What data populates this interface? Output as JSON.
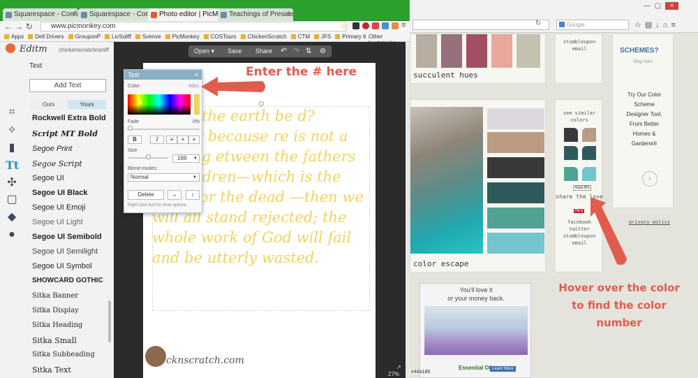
{
  "browser": {
    "tabs": [
      {
        "label": "Squarespace - Configurati",
        "active": false
      },
      {
        "label": "Squarespace - Configurati",
        "active": false
      },
      {
        "label": "Photo editor | PicMonkey",
        "active": true
      },
      {
        "label": "Teachings of Presidents of",
        "active": false
      }
    ],
    "url": "www.picmonkey.com",
    "bookmarks": [
      "Apps",
      "Dell Drivers",
      "GrouponP",
      "LivSoliff",
      "Svenve",
      "PicMonkey",
      "COSTours",
      "ChickenScratch",
      "CTM",
      "JFS",
      "Primary 6"
    ],
    "other_bookmarks": "Other bookmarks"
  },
  "editor": {
    "logo": "Editm",
    "account": "chickenscratchnsniff",
    "section_title": "Text",
    "add_text_label": "Add Text",
    "toggle_ours": "Ours",
    "toggle_yours": "Yours",
    "fonts": [
      "Rockwell Extra Bold",
      "Script MT Bold",
      "Segoe Print",
      "Segoe Script",
      "Segoe UI",
      "Segoe UI Black",
      "Segoe UI Emoji",
      "Segoe UI Light",
      "Segoe UI Semibold",
      "Segoe UI Semilight",
      "Segoe UI Symbol",
      "SHOWCARD GOTHIC",
      "Sitka Banner",
      "Sitka Display",
      "Sitka Heading",
      "Sitka Small",
      "Sitka Subheading",
      "Sitka Text"
    ],
    "toolbar": {
      "open": "Open",
      "save": "Save",
      "share": "Share"
    },
    "zoom": "27%"
  },
  "text_panel": {
    "title": "Text",
    "color_label": "Color:",
    "color_value": "4da1",
    "fade_label": "Fade",
    "fade_value": "0%",
    "fade_level": 0,
    "size_label": "Size",
    "size_value": "169",
    "blend_label": "Blend modes:",
    "blend_value": "Normal",
    "delete_label": "Delete",
    "hint": "Right-click text for more options."
  },
  "canvas": {
    "quote": "would the earth be d? Simply because re is not a welding etween the fathers he children—which is the work for the dead —then we will all stand rejected; the whole work of God will fail and be utterly wasted.",
    "watermark": "cknscratch.com",
    "text_color": "#f2d35a"
  },
  "annotations": {
    "top": "Enter the # here",
    "bottom": "Hover over the color to find the color number",
    "color": "#e05d4e"
  },
  "palette_site": {
    "search_placeholder": "Google",
    "schemes_heading": "SCHEMES?",
    "bhg": "bhg.com",
    "promo": "Try Our Color Scheme Designer Tool. From Better Homes & Gardens®",
    "share1": [
      "stumbleupon",
      "email"
    ],
    "caption_succulent": "succulent hues",
    "similar_label": "see similar colors",
    "hover_code": "4da1f85",
    "share_love": "share the love",
    "pin": "Pin it",
    "share2": [
      "facebook",
      "twitter",
      "stumbleupon",
      "email"
    ],
    "privacy": "privacy policy",
    "caption_escape": "color escape",
    "status_code": "e4da185",
    "ad_line1": "You'll love it",
    "ad_line2": "or your money back.",
    "ad_brand": "Essential Oils",
    "ad_cta": "Learn More",
    "top_swatches": [
      "#b7ada0",
      "#96707b",
      "#a24f62",
      "#e9a79b",
      "#c3c2b1"
    ],
    "escape_swatches": [
      "#ddd8df",
      "#bb9c83",
      "#393939",
      "#2e5a5b",
      "#4ea394",
      "#73c5cf"
    ],
    "similar_swatches": [
      "#393939",
      "#bb9c83",
      "#2e5a5b",
      "#2e5a5b",
      "#4ea394",
      "#73c5cf"
    ]
  }
}
